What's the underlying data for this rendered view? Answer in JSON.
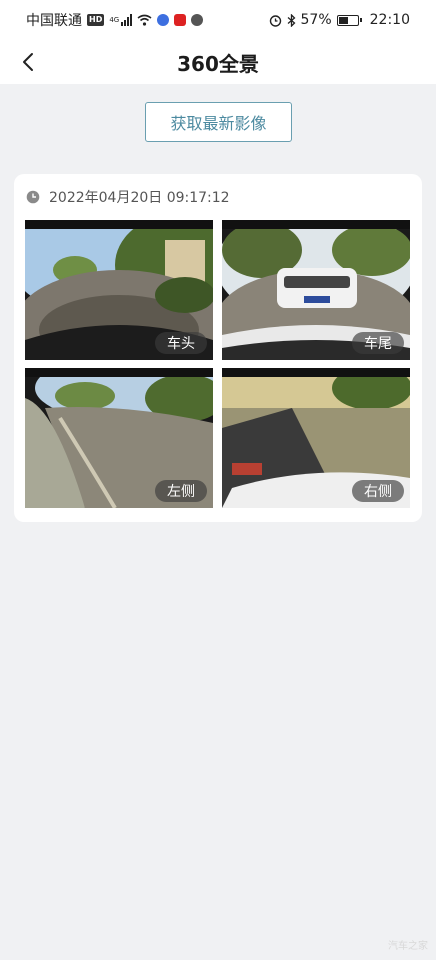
{
  "status_bar": {
    "carrier": "中国联通",
    "hd": "HD",
    "network": "4G",
    "battery_percent_text": "57%",
    "battery_level": 0.57,
    "time": "22:10"
  },
  "header": {
    "title": "360全景",
    "back_icon": "chevron-left-icon"
  },
  "fetch_button": {
    "label": "获取最新影像"
  },
  "snapshot": {
    "timestamp": "2022年04月20日 09:17:12",
    "tiles": [
      {
        "label": "车头"
      },
      {
        "label": "车尾"
      },
      {
        "label": "左侧"
      },
      {
        "label": "右侧"
      }
    ]
  },
  "watermark": "汽车之家",
  "colors": {
    "accent": "#4c8aa0",
    "background": "#f0f1f3"
  }
}
